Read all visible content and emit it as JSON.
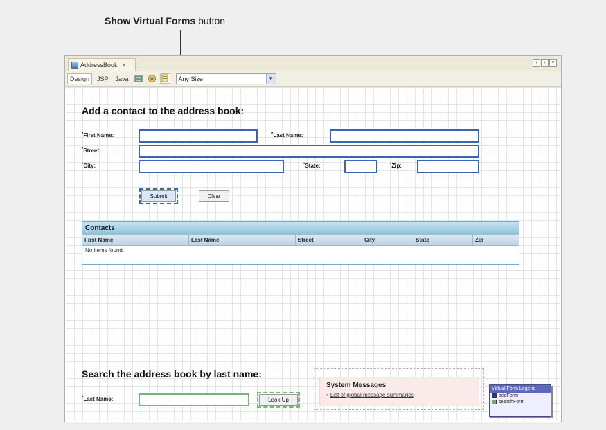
{
  "annotation": {
    "bold": "Show Virtual Forms",
    "rest": " button"
  },
  "tab": {
    "title": "AddressBook",
    "close": "×"
  },
  "window_controls": [
    "‹",
    "›",
    "▾"
  ],
  "toolbar": {
    "views": [
      "Design",
      "JSP",
      "Java"
    ],
    "size_select": {
      "value": "Any Size"
    }
  },
  "add_section": {
    "heading": "Add a contact to the address book:",
    "required_marker": "*",
    "first_name_label": "First Name:",
    "last_name_label": "Last Name:",
    "street_label": "Street:",
    "city_label": "City:",
    "state_label": "State:",
    "zip_label": "Zip:",
    "submit_label": "Submit",
    "clear_label": "Clear"
  },
  "contacts_table": {
    "title": "Contacts",
    "columns": [
      "First Name",
      "Last Name",
      "Street",
      "City",
      "State",
      "Zip"
    ],
    "empty_text": "No items found."
  },
  "search_section": {
    "heading": "Search the address book by last name:",
    "last_name_label": "Last Name:",
    "lookup_label": "Look Up"
  },
  "system_messages": {
    "title": "System Messages",
    "item": "List of global message summaries"
  },
  "legend": {
    "title": "Virtual Form Legend",
    "items": [
      {
        "name": "addForm",
        "color": "#1f3f8f"
      },
      {
        "name": "searchForm",
        "color": "#66b866"
      }
    ]
  }
}
